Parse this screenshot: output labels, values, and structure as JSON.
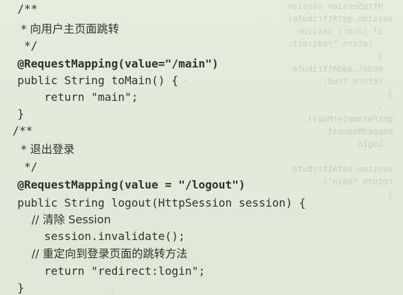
{
  "code_lines": [
    "/**",
    " * 向用户主页面跳转",
    " */",
    "@RequestMapping(value=\"/main\")",
    "public String toMain() {",
    "    return \"main\";",
    "}",
    "/**",
    " * 退出登录",
    " */",
    "@RequestMapping(value = \"/logout\")",
    "public String logout(HttpSession session) {",
    "    // 清除 Session",
    "    session.invalidate();",
    "    // 重定向到登录页面的跳转方法",
    "    return \"redirect:login\";",
    "}"
  ]
}
